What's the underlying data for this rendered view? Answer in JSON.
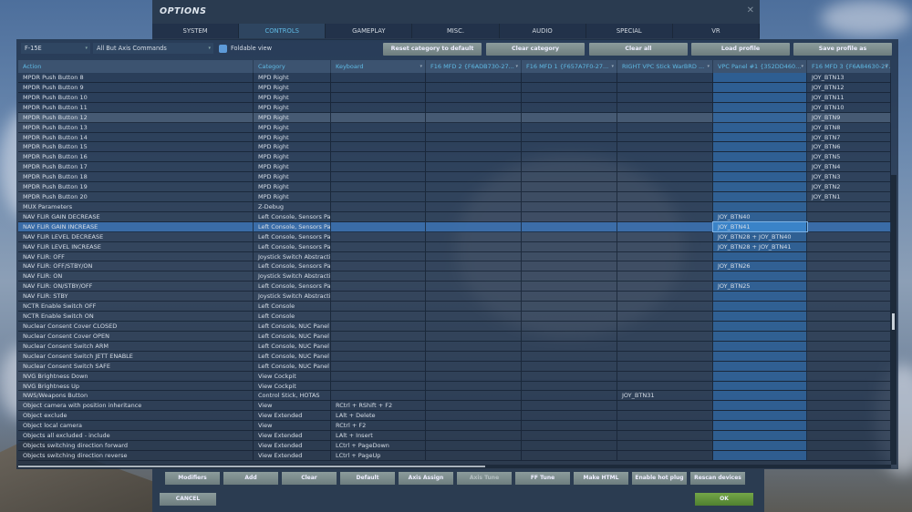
{
  "window": {
    "title": "OPTIONS",
    "close_icon": "close-icon"
  },
  "tabs": [
    "SYSTEM",
    "CONTROLS",
    "GAMEPLAY",
    "MISC.",
    "AUDIO",
    "SPECIAL",
    "VR"
  ],
  "active_tab": "CONTROLS",
  "toolbar": {
    "aircraft": "F-15E",
    "filter": "All But Axis Commands",
    "foldable_label": "Foldable view",
    "foldable_checked": true,
    "buttons": [
      "Reset category to default",
      "Clear category",
      "Clear all",
      "Load profile",
      "Save profile as"
    ]
  },
  "columns": [
    "Action",
    "Category",
    "Keyboard",
    "F16 MFD 2 {F6ADB730-27...",
    "F16 MFD 1 {F657A7F0-27...",
    "RIGHT VPC Stick WarBRD ...",
    "VPC Panel #1 {352DD460...",
    "F16 MFD 3 {F6A84630-27..."
  ],
  "rows": [
    [
      "MPDR Push Button  8",
      "MPD Right",
      "",
      "",
      "",
      "",
      "",
      "JOY_BTN13"
    ],
    [
      "MPDR Push Button  9",
      "MPD Right",
      "",
      "",
      "",
      "",
      "",
      "JOY_BTN12"
    ],
    [
      "MPDR Push Button 10",
      "MPD Right",
      "",
      "",
      "",
      "",
      "",
      "JOY_BTN11"
    ],
    [
      "MPDR Push Button 11",
      "MPD Right",
      "",
      "",
      "",
      "",
      "",
      "JOY_BTN10"
    ],
    [
      "MPDR Push Button 12",
      "MPD Right",
      "",
      "",
      "",
      "",
      "",
      "JOY_BTN9"
    ],
    [
      "MPDR Push Button 13",
      "MPD Right",
      "",
      "",
      "",
      "",
      "",
      "JOY_BTN8"
    ],
    [
      "MPDR Push Button 14",
      "MPD Right",
      "",
      "",
      "",
      "",
      "",
      "JOY_BTN7"
    ],
    [
      "MPDR Push Button 15",
      "MPD Right",
      "",
      "",
      "",
      "",
      "",
      "JOY_BTN6"
    ],
    [
      "MPDR Push Button 16",
      "MPD Right",
      "",
      "",
      "",
      "",
      "",
      "JOY_BTN5"
    ],
    [
      "MPDR Push Button 17",
      "MPD Right",
      "",
      "",
      "",
      "",
      "",
      "JOY_BTN4"
    ],
    [
      "MPDR Push Button 18",
      "MPD Right",
      "",
      "",
      "",
      "",
      "",
      "JOY_BTN3"
    ],
    [
      "MPDR Push Button 19",
      "MPD Right",
      "",
      "",
      "",
      "",
      "",
      "JOY_BTN2"
    ],
    [
      "MPDR Push Button 20",
      "MPD Right",
      "",
      "",
      "",
      "",
      "",
      "JOY_BTN1"
    ],
    [
      "MUX Parameters",
      "Z-Debug",
      "",
      "",
      "",
      "",
      "",
      ""
    ],
    [
      "NAV FLIR GAIN DECREASE",
      "Left Console, Sensors Pan",
      "",
      "",
      "",
      "",
      "JOY_BTN40",
      ""
    ],
    [
      "NAV FLIR GAIN INCREASE",
      "Left Console, Sensors Pan",
      "",
      "",
      "",
      "",
      "JOY_BTN41",
      ""
    ],
    [
      "NAV FLIR LEVEL DECREASE",
      "Left Console, Sensors Pan",
      "",
      "",
      "",
      "",
      "JOY_BTN28 + JOY_BTN40",
      ""
    ],
    [
      "NAV FLIR LEVEL INCREASE",
      "Left Console, Sensors Pan",
      "",
      "",
      "",
      "",
      "JOY_BTN28 + JOY_BTN41",
      ""
    ],
    [
      "NAV FLIR: OFF",
      "Joystick Switch Abstractio",
      "",
      "",
      "",
      "",
      "",
      ""
    ],
    [
      "NAV FLIR: OFF/STBY/ON",
      "Left Console, Sensors Pan",
      "",
      "",
      "",
      "",
      "JOY_BTN26",
      ""
    ],
    [
      "NAV FLIR: ON",
      "Joystick Switch Abstractio",
      "",
      "",
      "",
      "",
      "",
      ""
    ],
    [
      "NAV FLIR: ON/STBY/OFF",
      "Left Console, Sensors Pan",
      "",
      "",
      "",
      "",
      "JOY_BTN25",
      ""
    ],
    [
      "NAV FLIR: STBY",
      "Joystick Switch Abstractio",
      "",
      "",
      "",
      "",
      "",
      ""
    ],
    [
      "NCTR Enable Switch OFF",
      "Left Console",
      "",
      "",
      "",
      "",
      "",
      ""
    ],
    [
      "NCTR Enable Switch ON",
      "Left Console",
      "",
      "",
      "",
      "",
      "",
      ""
    ],
    [
      "Nuclear Consent Cover CLOSED",
      "Left Console, NUC Panel",
      "",
      "",
      "",
      "",
      "",
      ""
    ],
    [
      "Nuclear Consent Cover OPEN",
      "Left Console, NUC Panel",
      "",
      "",
      "",
      "",
      "",
      ""
    ],
    [
      "Nuclear Consent Switch ARM",
      "Left Console, NUC Panel",
      "",
      "",
      "",
      "",
      "",
      ""
    ],
    [
      "Nuclear Consent Switch JETT ENABLE",
      "Left Console, NUC Panel",
      "",
      "",
      "",
      "",
      "",
      ""
    ],
    [
      "Nuclear Consent Switch SAFE",
      "Left Console, NUC Panel",
      "",
      "",
      "",
      "",
      "",
      ""
    ],
    [
      "NVG Brightness Down",
      "View Cockpit",
      "",
      "",
      "",
      "",
      "",
      ""
    ],
    [
      "NVG Brightness Up",
      "View Cockpit",
      "",
      "",
      "",
      "",
      "",
      ""
    ],
    [
      "NWS/Weapons Button",
      "Control Stick, HOTAS",
      "",
      "",
      "",
      "JOY_BTN31",
      "",
      ""
    ],
    [
      "Object camera with position inheritance",
      "View",
      "RCtrl + RShift + F2",
      "",
      "",
      "",
      "",
      ""
    ],
    [
      "Object exclude",
      "View Extended",
      "LAlt + Delete",
      "",
      "",
      "",
      "",
      ""
    ],
    [
      "Object local camera",
      "View",
      "RCtrl + F2",
      "",
      "",
      "",
      "",
      ""
    ],
    [
      "Objects all excluded - include",
      "View Extended",
      "LAlt + Insert",
      "",
      "",
      "",
      "",
      ""
    ],
    [
      "Objects switching direction forward",
      "View Extended",
      "LCtrl + PageDown",
      "",
      "",
      "",
      "",
      ""
    ],
    [
      "Objects switching direction reverse",
      "View Extended",
      "LCtrl + PageUp",
      "",
      "",
      "",
      "",
      ""
    ]
  ],
  "hover_row": 4,
  "selected_row": 15,
  "bottom_buttons": [
    "Modifiers",
    "Add",
    "Clear",
    "Default",
    "Axis Assign",
    "Axis Tune",
    "FF Tune",
    "Make HTML",
    "Enable hot plug",
    "Rescan devices"
  ],
  "disabled_buttons": [
    "Axis Tune"
  ],
  "cancel": "CANCEL",
  "ok": "OK",
  "colors": {
    "accent": "#5fb9e3",
    "ok": "#5f9a3c",
    "highlight_column": "#30699f"
  }
}
